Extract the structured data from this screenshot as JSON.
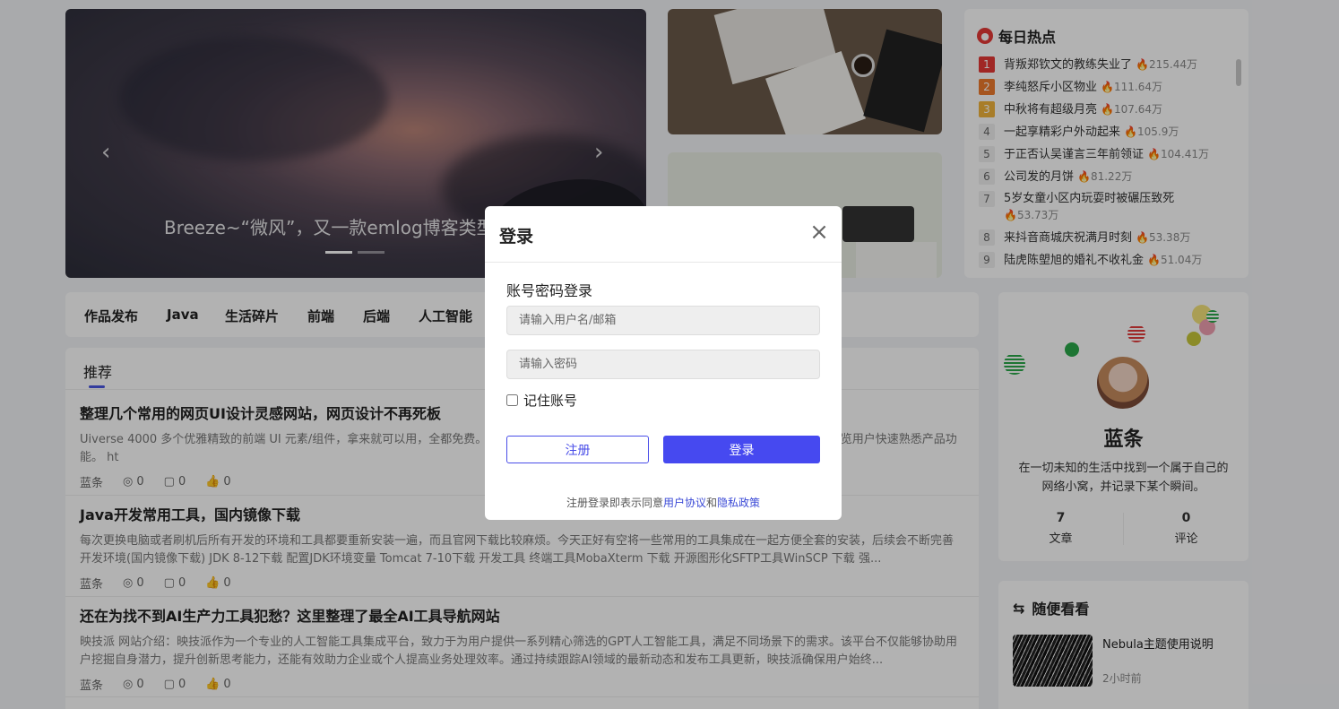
{
  "slider": {
    "caption": "Breeze~“微风”，又一款emlog博客类型主",
    "prev_icon": "chevron-left-icon",
    "next_icon": "chevron-right-icon"
  },
  "hot": {
    "title": "每日热点",
    "items": [
      {
        "rank": "1",
        "title": "背叛郑钦文的教练失业了",
        "heat": "215.44万"
      },
      {
        "rank": "2",
        "title": "李纯怒斥小区物业",
        "heat": "111.64万"
      },
      {
        "rank": "3",
        "title": "中秋将有超级月亮",
        "heat": "107.64万"
      },
      {
        "rank": "4",
        "title": "一起享精彩户外动起来",
        "heat": "105.9万"
      },
      {
        "rank": "5",
        "title": "于正否认吴谨言三年前领证",
        "heat": "104.41万"
      },
      {
        "rank": "6",
        "title": "公司发的月饼",
        "heat": "81.22万"
      },
      {
        "rank": "7",
        "title": "5岁女童小区内玩耍时被碾压致死",
        "heat": "53.73万"
      },
      {
        "rank": "8",
        "title": "来抖音商城庆祝满月时刻",
        "heat": "53.38万"
      },
      {
        "rank": "9",
        "title": "陆虎陈塱旭的婚礼不收礼金",
        "heat": "51.04万"
      }
    ]
  },
  "nav": {
    "items": [
      "作品发布",
      "Java",
      "生活碎片",
      "前端",
      "后端",
      "人工智能"
    ]
  },
  "list": {
    "tab": "推荐",
    "articles": [
      {
        "title": "整理几个常用的网页UI设计灵感网站，网页设计不再死板",
        "desc": "Uiverse 4000 多个优雅精致的前端 UI 元素/组件，拿来就可以用，全都免费。                                                                                          pt类库，可用于产品导览、亮点、上下文帮助等，从而一步一步地导览用户快速熟悉产品功能。 ht",
        "author": "蓝条",
        "views": "0",
        "comments": "0",
        "likes": "0"
      },
      {
        "title": "Java开发常用工具，国内镜像下载",
        "desc": "每次更换电脑或者刷机后所有开发的环境和工具都要重新安装一遍，而且官网下载比较麻烦。今天正好有空将一些常用的工具集成在一起方便全套的安装，后续会不断完善 开发环境(国内镜像下载) JDK 8-12下载 配置JDK环境变量 Tomcat 7-10下载 开发工具 终端工具MobaXterm 下载 开源图形化SFTP工具WinSCP 下载 强...",
        "author": "蓝条",
        "views": "0",
        "comments": "0",
        "likes": "0"
      },
      {
        "title": "还在为找不到AI生产力工具犯愁？这里整理了最全AI工具导航网站",
        "desc": "映技派 网站介绍：映技派作为一个专业的人工智能工具集成平台，致力于为用户提供一系列精心筛选的GPT人工智能工具，满足不同场景下的需求。该平台不仅能够协助用户挖掘自身潜力，提升创新思考能力，还能有效助力企业或个人提高业务处理效率。通过持续跟踪AI领域的最新动态和发布工具更新，映技派确保用户始终...",
        "author": "蓝条",
        "views": "0",
        "comments": "0",
        "likes": "0"
      }
    ]
  },
  "profile": {
    "name": "蓝条",
    "desc": "在一切未知的生活中找到一个属于自己的网络小窝，并记录下某个瞬间。",
    "articles_count": "7",
    "articles_label": "文章",
    "comments_count": "0",
    "comments_label": "评论"
  },
  "random": {
    "title": "随便看看",
    "item_title": "Nebula主题使用说明",
    "item_time": "2小时前"
  },
  "modal": {
    "title": "登录",
    "subtitle": "账号密码登录",
    "username_placeholder": "请输入用户名/邮箱",
    "password_placeholder": "请输入密码",
    "remember_label": "记住账号",
    "register_label": "注册",
    "login_label": "登录",
    "agree_prefix": "注册登录即表示同意",
    "agree_terms": "用户协议",
    "agree_and": "和",
    "agree_privacy": "隐私政策"
  },
  "colors": {
    "accent": "#4649f0",
    "rank1": "#e53935",
    "rank2": "#ee7a2d",
    "rank3": "#f1b33c"
  }
}
